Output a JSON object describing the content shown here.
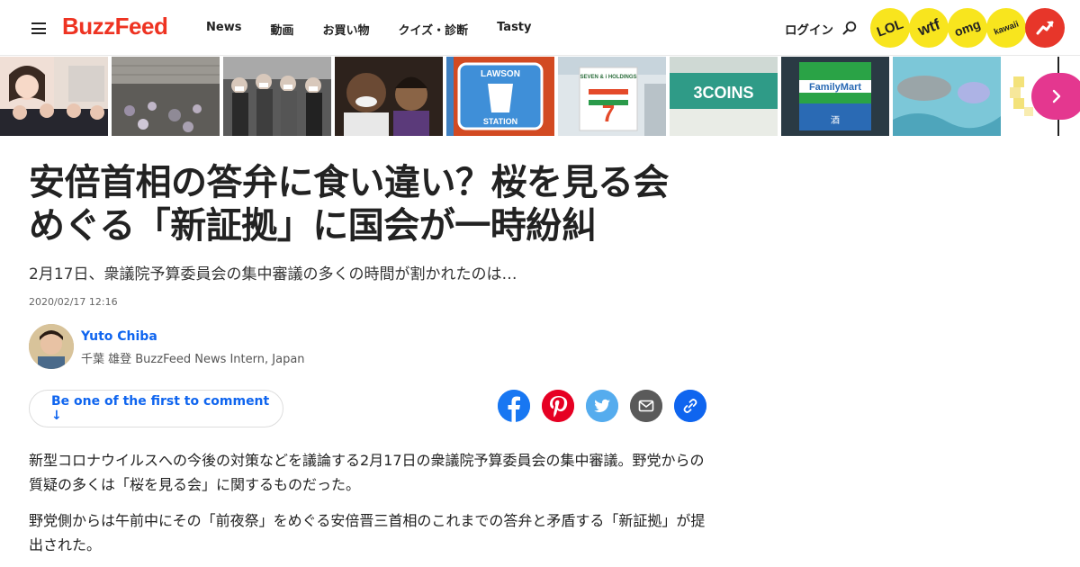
{
  "header": {
    "logo": "BuzzFeed",
    "nav": [
      "News",
      "動画",
      "お買い物",
      "クイズ・診断",
      "Tasty"
    ],
    "login": "ログイン",
    "badges": [
      "LOL",
      "wtf",
      "omg",
      "kawaii"
    ]
  },
  "strip": {
    "thumbs": [
      {
        "name": "thumb-people",
        "color": "#d9c9bd"
      },
      {
        "name": "thumb-warehouse",
        "color": "#7d7a75"
      },
      {
        "name": "thumb-crowd-masks",
        "color": "#4e4e4e"
      },
      {
        "name": "thumb-basketball-player",
        "color": "#3a2c26"
      },
      {
        "name": "thumb-lawson",
        "color": "#3f8fd8",
        "text": "LAWSON STATION"
      },
      {
        "name": "thumb-seven-eleven",
        "color": "#d8e2e6",
        "text": "SEVEN & i HOLDINGS"
      },
      {
        "name": "thumb-3coins",
        "color": "#3a9a8a",
        "text": "3COINS"
      },
      {
        "name": "thumb-familymart",
        "color": "#2aa346",
        "text": "FamilyMart"
      },
      {
        "name": "thumb-sea-creature",
        "color": "#7fc8d8"
      },
      {
        "name": "thumb-pixel",
        "color": "#fbf5d8"
      }
    ]
  },
  "article": {
    "headline": "安倍首相の答弁に食い違い？桜を見る会めぐる「新証拠」に国会が一時紛糾",
    "subhead": "2月17日、衆議院予算委員会の集中審議の多くの時間が割かれたのは…",
    "timestamp": "2020/02/17 12:16",
    "author_name": "Yuto Chiba",
    "author_title": "千葉 雄登 BuzzFeed News Intern, Japan",
    "comment_cta": "Be one of the first to comment ↓",
    "paragraphs": [
      "新型コロナウイルスへの今後の対策などを議論する2月17日の衆議院予算委員会の集中審議。野党からの質疑の多くは「桜を見る会」に関するものだった。",
      "野党側からは午前中にその「前夜祭」をめぐる安倍晋三首相のこれまでの答弁と矛盾する「新証拠」が提出された。"
    ]
  },
  "colors": {
    "brand": "#ee3322",
    "link": "#0f65ef",
    "facebook": "#1877f2",
    "pinterest": "#e60023",
    "twitter": "#55acee",
    "email": "#5a5a5a",
    "copy_link": "#0f65ef",
    "badge_yellow": "#f8e51e",
    "trending": "#e7362a",
    "next_button": "#e4378f"
  },
  "icons": {
    "menu": "hamburger-icon",
    "search": "search-icon",
    "trending": "trending-arrow-icon",
    "next": "chevron-right-icon",
    "share": [
      "facebook-icon",
      "pinterest-icon",
      "twitter-icon",
      "email-icon",
      "link-icon"
    ]
  }
}
